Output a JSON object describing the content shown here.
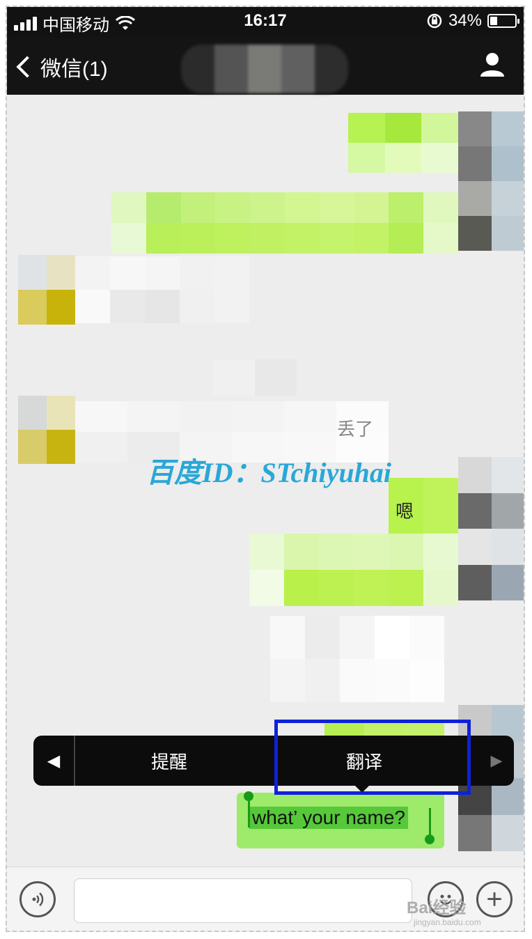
{
  "status_bar": {
    "carrier": "中国移动",
    "time": "16:17",
    "battery_percent": "34%"
  },
  "nav": {
    "back_label": "微信(1)"
  },
  "chat": {
    "partial_message_1": "丢了",
    "partial_message_2": "嗯"
  },
  "watermark": "百度ID：STchiyuhai",
  "context_menu": {
    "item_remind": "提醒",
    "item_translate": "翻译"
  },
  "selected_message": "what’ your name?",
  "footer_watermark": {
    "brand": "Bai经验",
    "url": "jingyan.baidu.com"
  },
  "colors": {
    "highlight_box": "#0e21d9",
    "bubble_green": "#9eea6a",
    "watermark_text": "#29a7d8"
  }
}
